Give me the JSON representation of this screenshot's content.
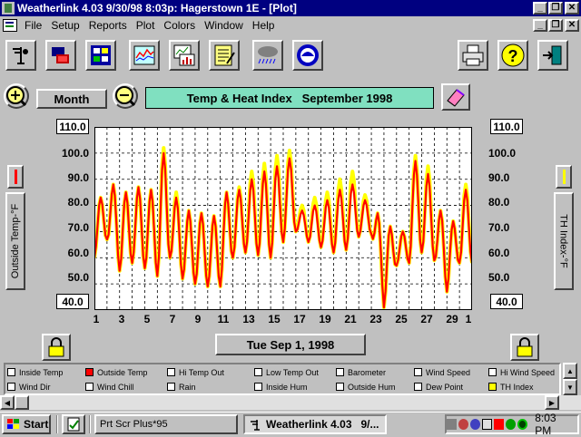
{
  "window": {
    "title": "Weatherlink 4.03   9/30/98   8:03p:  Hagerstown 1E - [Plot]"
  },
  "menu": [
    "File",
    "Setup",
    "Reports",
    "Plot",
    "Colors",
    "Window",
    "Help"
  ],
  "toolbar": {
    "left_icons": [
      "anemometer-icon",
      "station-icon",
      "dashboard-icon",
      "plot-icon",
      "chart-icon",
      "notepad-icon",
      "storm-icon",
      "noaa-icon"
    ],
    "right_icons": [
      "printer-icon",
      "help-icon",
      "exit-icon"
    ]
  },
  "controls": {
    "period_label": "Month",
    "plot_title": "Temp & Heat Index   September 1998",
    "date_label": "Tue Sep 1, 1998",
    "left_axis_label": "Outside Temp-°F",
    "right_axis_label": "TH Index-°F"
  },
  "axis": {
    "left_top": "110.0",
    "left_bottom": "40.0",
    "right_top": "110.0",
    "right_bottom": "40.0",
    "y_ticks": [
      "100.0",
      "90.0",
      "80.0",
      "70.0",
      "60.0",
      "50.0"
    ],
    "x_ticks": [
      "1",
      "3",
      "5",
      "7",
      "9",
      "11",
      "13",
      "15",
      "17",
      "19",
      "21",
      "23",
      "25",
      "27",
      "29",
      "1"
    ]
  },
  "legend": [
    {
      "label": "Inside Temp",
      "color": "#ffffff"
    },
    {
      "label": "Outside Temp",
      "color": "#ff0000"
    },
    {
      "label": "Hi Temp Out",
      "color": "#ffffff"
    },
    {
      "label": "Low Temp Out",
      "color": "#ffffff"
    },
    {
      "label": "Barometer",
      "color": "#ffffff"
    },
    {
      "label": "Wind Speed",
      "color": "#ffffff"
    },
    {
      "label": "Hi Wind Speed",
      "color": "#ffffff"
    },
    {
      "label": "Wind Dir",
      "color": "#ffffff"
    },
    {
      "label": "Wind Chill",
      "color": "#ffffff"
    },
    {
      "label": "Rain",
      "color": "#ffffff"
    },
    {
      "label": "Inside Hum",
      "color": "#ffffff"
    },
    {
      "label": "Outside Hum",
      "color": "#ffffff"
    },
    {
      "label": "Dew Point",
      "color": "#ffffff"
    },
    {
      "label": "TH Index",
      "color": "#ffff00"
    }
  ],
  "taskbar": {
    "start": "Start",
    "tasks": [
      "Prt Scr Plus*95",
      "Weatherlink 4.03   9/..."
    ],
    "clock": "8:03 PM"
  },
  "colors": {
    "titlebar": "#000080",
    "title_strip": "#80e0c0",
    "outside_temp": "#ff0000",
    "th_index": "#ffff00"
  },
  "chart_data": {
    "type": "line",
    "x_unit": "day",
    "ylim": [
      40,
      110
    ],
    "xlim": [
      1,
      31
    ],
    "series": [
      {
        "name": "Outside Temp",
        "color": "#ff0000",
        "lows": [
          60,
          67,
          55,
          58,
          56,
          53,
          60,
          52,
          50,
          49,
          49,
          60,
          62,
          61,
          60,
          66,
          70,
          66,
          64,
          62,
          63,
          68,
          69,
          41,
          57,
          58,
          62,
          59,
          47,
          58
        ],
        "highs": [
          83,
          88,
          85,
          87,
          86,
          100,
          83,
          78,
          77,
          76,
          85,
          86,
          90,
          93,
          95,
          98,
          78,
          80,
          82,
          86,
          88,
          82,
          77,
          72,
          70,
          97,
          92,
          78,
          74,
          86
        ]
      },
      {
        "name": "TH Index",
        "color": "#ffff00",
        "lows": [
          60,
          67,
          55,
          58,
          56,
          53,
          60,
          52,
          50,
          49,
          49,
          60,
          62,
          61,
          60,
          66,
          70,
          66,
          64,
          62,
          63,
          68,
          69,
          41,
          57,
          58,
          62,
          59,
          47,
          58
        ],
        "highs": [
          83,
          88,
          85,
          87,
          86,
          102,
          85,
          78,
          77,
          76,
          85,
          87,
          93,
          96,
          99,
          101,
          80,
          83,
          85,
          90,
          93,
          84,
          77,
          72,
          70,
          99,
          95,
          78,
          74,
          88
        ]
      }
    ]
  }
}
